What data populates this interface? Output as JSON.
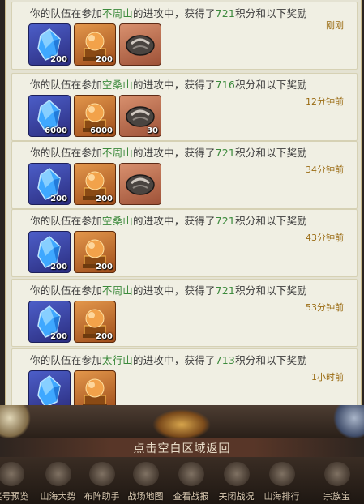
{
  "entries": [
    {
      "prefix": "你的队伍在参加",
      "mountain": "不周山",
      "middle": "的进攻中，获得了",
      "points": "721",
      "suffix": "积分和以下奖励",
      "time": "刚刚",
      "items": [
        {
          "kind": "blue-crystal",
          "qty": "200"
        },
        {
          "kind": "orange-orb",
          "qty": "200"
        },
        {
          "kind": "stone-ore",
          "qty": ""
        }
      ]
    },
    {
      "prefix": "你的队伍在参加",
      "mountain": "空桑山",
      "middle": "的进攻中，获得了",
      "points": "716",
      "suffix": "积分和以下奖励",
      "time": "12分钟前",
      "items": [
        {
          "kind": "blue-crystal",
          "qty": "6000"
        },
        {
          "kind": "orange-orb",
          "qty": "6000"
        },
        {
          "kind": "stone-ore",
          "qty": "30"
        }
      ]
    },
    {
      "prefix": "你的队伍在参加",
      "mountain": "不周山",
      "middle": "的进攻中，获得了",
      "points": "721",
      "suffix": "积分和以下奖励",
      "time": "34分钟前",
      "items": [
        {
          "kind": "blue-crystal",
          "qty": "200"
        },
        {
          "kind": "orange-orb",
          "qty": "200"
        },
        {
          "kind": "stone-ore",
          "qty": ""
        }
      ]
    },
    {
      "prefix": "你的队伍在参加",
      "mountain": "空桑山",
      "middle": "的进攻中，获得了",
      "points": "721",
      "suffix": "积分和以下奖励",
      "time": "43分钟前",
      "items": [
        {
          "kind": "blue-crystal",
          "qty": "200"
        },
        {
          "kind": "orange-orb",
          "qty": "200"
        }
      ]
    },
    {
      "prefix": "你的队伍在参加",
      "mountain": "不周山",
      "middle": "的进攻中，获得了",
      "points": "721",
      "suffix": "积分和以下奖励",
      "time": "53分钟前",
      "items": [
        {
          "kind": "blue-crystal",
          "qty": "200"
        },
        {
          "kind": "orange-orb",
          "qty": "200"
        }
      ]
    },
    {
      "prefix": "你的队伍在参加",
      "mountain": "太行山",
      "middle": "的进攻中，获得了",
      "points": "713",
      "suffix": "积分和以下奖励",
      "time": "1小时前",
      "items": [
        {
          "kind": "blue-crystal",
          "qty": ""
        },
        {
          "kind": "orange-orb",
          "qty": ""
        }
      ]
    }
  ],
  "return_hint": "点击空白区域返回",
  "nav": [
    {
      "label": "奖号预览",
      "icon": "gift-icon"
    },
    {
      "label": "山海大势",
      "icon": "mountain-icon"
    },
    {
      "label": "布阵助手",
      "icon": "formation-icon"
    },
    {
      "label": "战场地图",
      "icon": "map-icon"
    },
    {
      "label": "查看战报",
      "icon": "report-icon"
    },
    {
      "label": "关闭战况",
      "icon": "eye-icon"
    },
    {
      "label": "山海排行",
      "icon": "ranking-icon"
    },
    {
      "label": "宗族宝",
      "icon": "treasure-icon"
    }
  ],
  "colors": {
    "panel": "#e4e2d2",
    "entry": "#f0efe3",
    "green": "#3c8a3c",
    "time": "#9a6b12"
  }
}
